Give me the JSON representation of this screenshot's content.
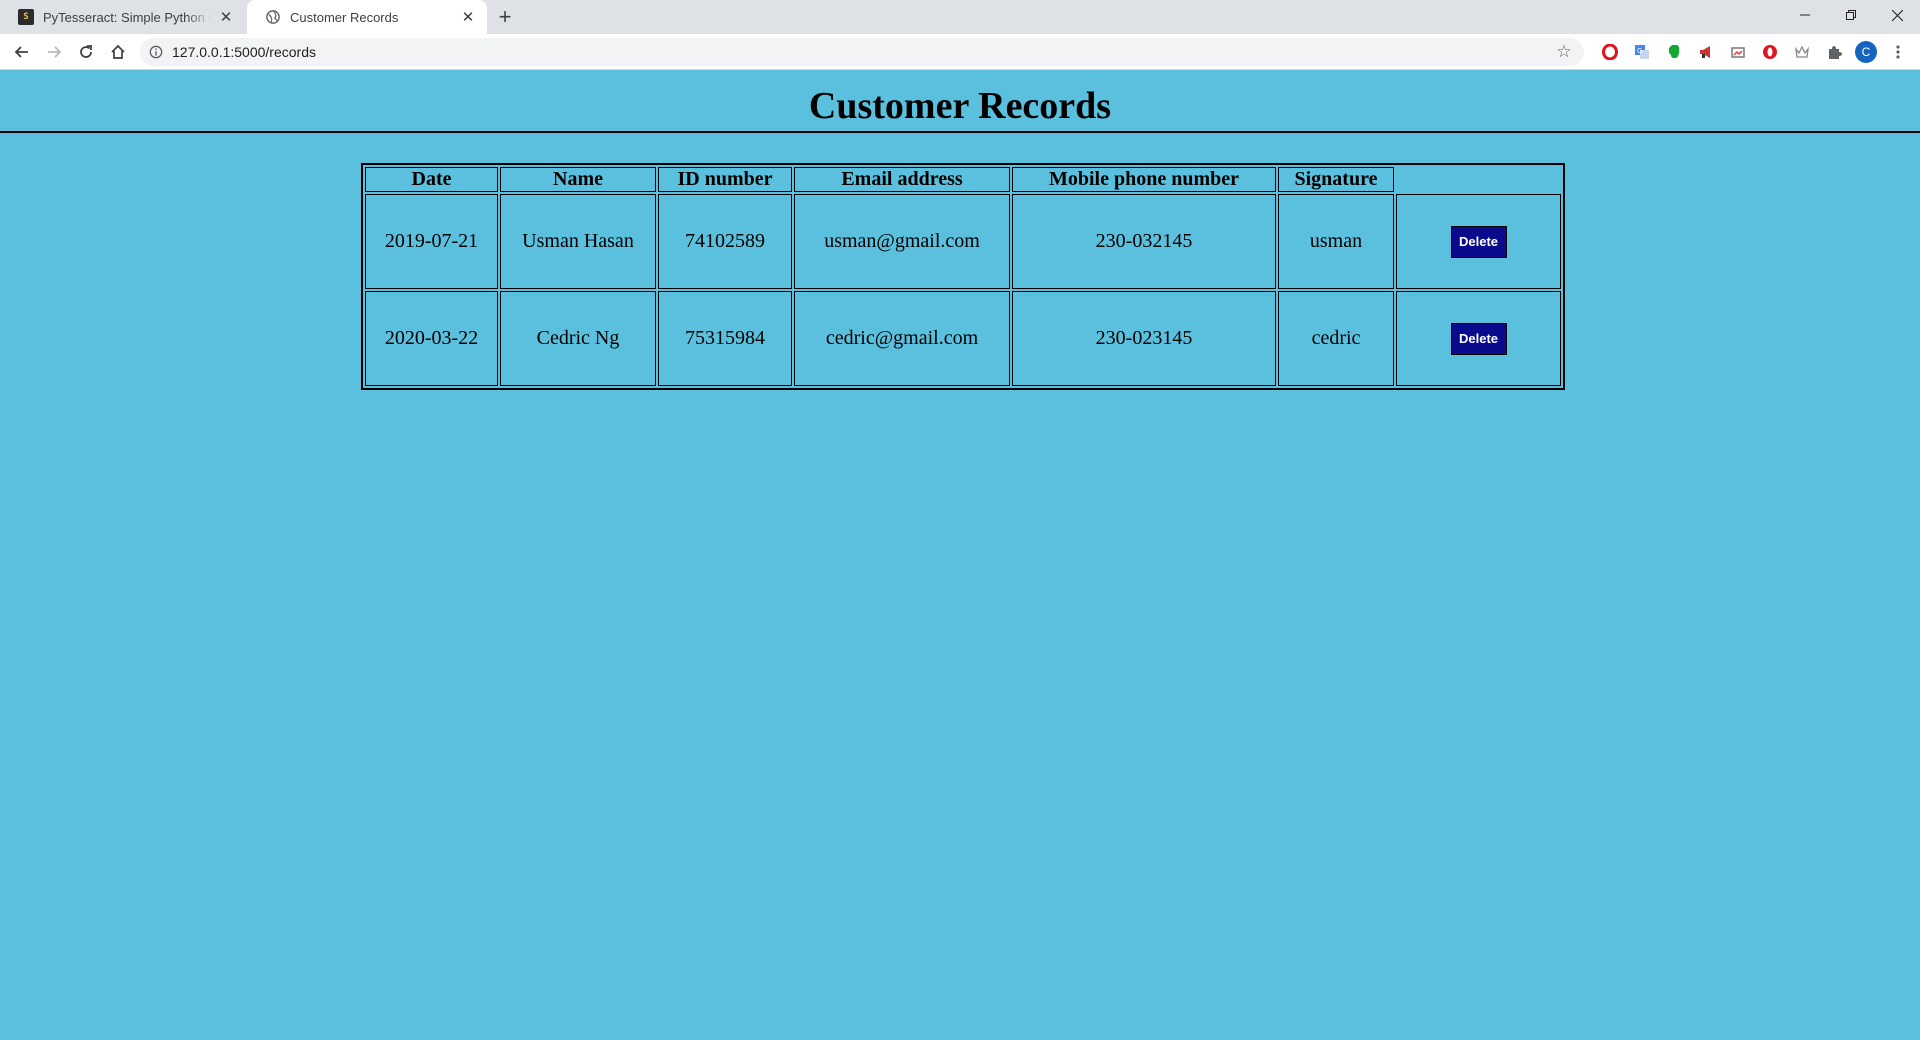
{
  "browser": {
    "tabs": [
      {
        "title": "PyTesseract: Simple Python Optic",
        "favicon": "S"
      },
      {
        "title": "Customer Records"
      }
    ],
    "url": "127.0.0.1:5000/records",
    "profile_initial": "C",
    "extension_icons": [
      "opera-icon",
      "google-translate-icon",
      "evernote-icon",
      "megaphone-icon",
      "screenshot-icon",
      "opera-red-icon",
      "crown-icon",
      "puzzle-icon"
    ]
  },
  "page": {
    "title": "Customer Records",
    "table": {
      "headers": [
        "Date",
        "Name",
        "ID number",
        "Email address",
        "Mobile phone number",
        "Signature",
        ""
      ],
      "rows": [
        {
          "date": "2019-07-21",
          "name": "Usman Hasan",
          "id_number": "74102589",
          "email": "usman@gmail.com",
          "mobile": "230-032145",
          "signature": "usman",
          "action": "Delete"
        },
        {
          "date": "2020-03-22",
          "name": "Cedric Ng",
          "id_number": "75315984",
          "email": "cedric@gmail.com",
          "mobile": "230-023145",
          "signature": "cedric",
          "action": "Delete"
        }
      ]
    }
  }
}
